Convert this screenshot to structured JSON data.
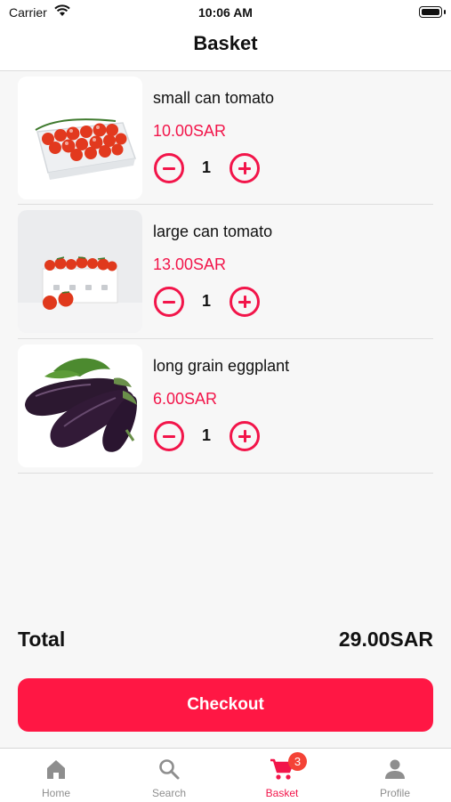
{
  "status_bar": {
    "carrier": "Carrier",
    "time": "10:06 AM"
  },
  "header": {
    "title": "Basket"
  },
  "items": [
    {
      "name": "small can tomato",
      "price": "10.00SAR",
      "quantity": "1"
    },
    {
      "name": "large can tomato",
      "price": "13.00SAR",
      "quantity": "1"
    },
    {
      "name": "long grain eggplant",
      "price": "6.00SAR",
      "quantity": "1"
    }
  ],
  "summary": {
    "total_label": "Total",
    "total_value": "29.00SAR"
  },
  "checkout": {
    "label": "Checkout"
  },
  "tabbar": {
    "tabs": [
      {
        "label": "Home",
        "icon": "home-icon"
      },
      {
        "label": "Search",
        "icon": "search-icon"
      },
      {
        "label": "Basket",
        "icon": "cart-icon",
        "badge": "3",
        "active": true
      },
      {
        "label": "Profile",
        "icon": "person-icon"
      }
    ]
  },
  "colors": {
    "accent": "#f2154a",
    "checkout": "#ff1744",
    "badge": "#f44336",
    "inactive_tab": "#8e8e8e"
  }
}
